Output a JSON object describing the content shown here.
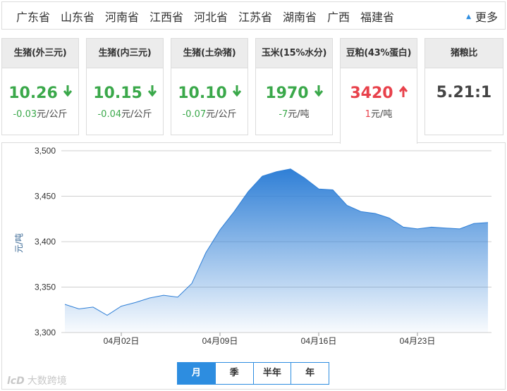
{
  "provinces": [
    "广东省",
    "山东省",
    "河南省",
    "江西省",
    "河北省",
    "江苏省",
    "湖南省",
    "广西",
    "福建省"
  ],
  "more_label": "更多",
  "cards": [
    {
      "title": "生猪(外三元)",
      "price": "10.26",
      "direction": "down",
      "change": "-0.03",
      "unit": "元/公斤"
    },
    {
      "title": "生猪(内三元)",
      "price": "10.15",
      "direction": "down",
      "change": "-0.04",
      "unit": "元/公斤"
    },
    {
      "title": "生猪(土杂猪)",
      "price": "10.10",
      "direction": "down",
      "change": "-0.07",
      "unit": "元/公斤"
    },
    {
      "title": "玉米(15%水分)",
      "price": "1970",
      "direction": "down",
      "change": "-7",
      "unit": "元/吨"
    },
    {
      "title": "豆粕(43%蛋白)",
      "price": "3420",
      "direction": "up",
      "change": "1",
      "unit": "元/吨"
    },
    {
      "title": "猪粮比",
      "price": "5.21:1",
      "direction": "none",
      "change": "",
      "unit": ""
    }
  ],
  "colors": {
    "down": "#3aa84a",
    "up": "#e8414b",
    "accent": "#2d8de0",
    "area_top": "#2f7fd6"
  },
  "icons": {
    "down": "arrow-down-icon",
    "up": "arrow-up-icon",
    "more": "triangle-up-icon"
  },
  "chart_data": {
    "type": "area",
    "title": "",
    "xlabel": "",
    "ylabel": "元/吨",
    "ylim": [
      3300,
      3500
    ],
    "yticks": [
      3300,
      3350,
      3400,
      3450,
      3500
    ],
    "ytick_labels": [
      "3,300",
      "3,350",
      "3,400",
      "3,450",
      "3,500"
    ],
    "grid": true,
    "x": [
      "03-29",
      "03-30",
      "03-31",
      "04-01",
      "04-02",
      "04-03",
      "04-04",
      "04-05",
      "04-06",
      "04-07",
      "04-08",
      "04-09",
      "04-10",
      "04-11",
      "04-12",
      "04-13",
      "04-14",
      "04-15",
      "04-16",
      "04-17",
      "04-18",
      "04-19",
      "04-20",
      "04-21",
      "04-22",
      "04-23",
      "04-24",
      "04-25",
      "04-26",
      "04-27",
      "04-28"
    ],
    "xtick_labels": [
      "04月02日",
      "04月09日",
      "04月16日",
      "04月23日"
    ],
    "xtick_at": [
      "04-02",
      "04-09",
      "04-16",
      "04-23"
    ],
    "series": [
      {
        "name": "",
        "values": [
          3331,
          3326,
          3328,
          3319,
          3329,
          3333,
          3338,
          3341,
          3339,
          3354,
          3388,
          3413,
          3433,
          3455,
          3472,
          3477,
          3480,
          3470,
          3458,
          3457,
          3440,
          3433,
          3431,
          3426,
          3416,
          3414,
          3416,
          3415,
          3414,
          3420,
          3421
        ]
      }
    ]
  },
  "tabs": [
    {
      "label": "月",
      "active": true
    },
    {
      "label": "季",
      "active": false
    },
    {
      "label": "半年",
      "active": false
    },
    {
      "label": "年",
      "active": false
    }
  ],
  "watermark": {
    "logo": "lcD",
    "text": "大数跨境"
  }
}
